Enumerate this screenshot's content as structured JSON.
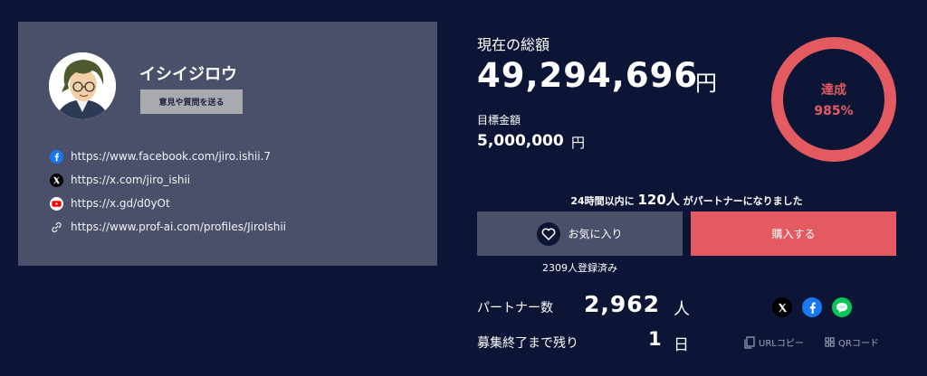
{
  "profile": {
    "name": "イシイジロウ",
    "feedback_button": "意見や質問を送る",
    "links": [
      {
        "icon": "facebook-icon",
        "text": "https://www.facebook.com/jiro.ishii.7"
      },
      {
        "icon": "x-icon",
        "text": "https://x.com/jiro_ishii"
      },
      {
        "icon": "youtube-icon",
        "text": "https://x.gd/d0yOt"
      },
      {
        "icon": "link-icon",
        "text": "https://www.prof-ai.com/profiles/JiroIshii"
      }
    ]
  },
  "funding": {
    "total_label": "現在の総額",
    "total_amount": "49,294,696",
    "total_unit": "円",
    "goal_label": "目標金額",
    "goal_amount": "5,000,000",
    "goal_unit": "円",
    "achievement_label": "達成",
    "achievement_percent": "985%"
  },
  "activity": {
    "prefix": "24時間以内に",
    "count": "120人",
    "suffix": "がパートナーになりました"
  },
  "actions": {
    "favorite_label": "お気に入り",
    "buy_label": "購入する",
    "registered_text": "2309人登録済み"
  },
  "stats": {
    "partners_label": "パートナー数",
    "partners_count": "2,962",
    "partners_unit": "人",
    "remaining_label": "募集終了まで残り",
    "remaining_count": "1",
    "remaining_unit": "日"
  },
  "share": {
    "url_copy": "URLコピー",
    "qr_code": "QRコード"
  },
  "colors": {
    "background": "#0d1536",
    "card": "#4a506a",
    "accent": "#e35a61"
  }
}
